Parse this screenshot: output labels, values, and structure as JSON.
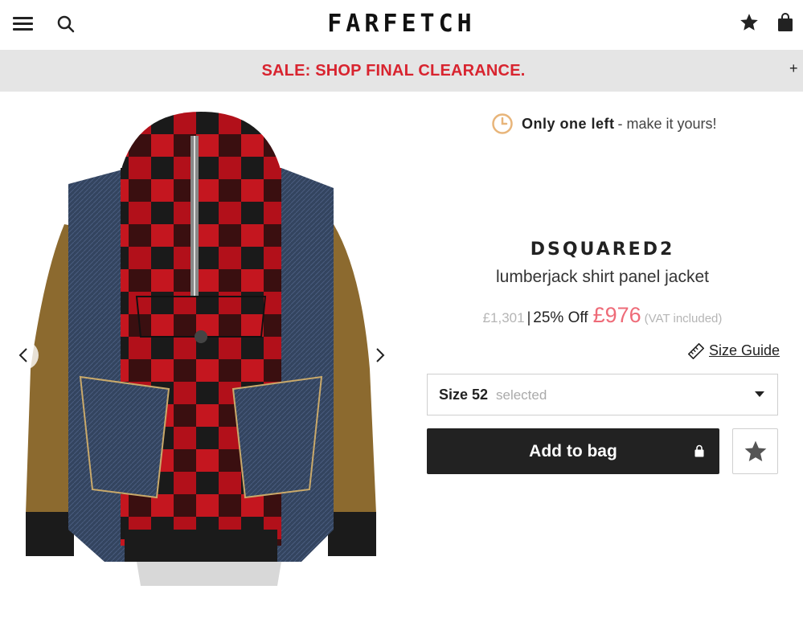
{
  "header": {
    "logo": "FARFETCH",
    "menu_icon": "hamburger-menu-icon",
    "search_icon": "search-icon",
    "wishlist_icon": "star-icon",
    "bag_icon": "shopping-bag-icon"
  },
  "banner": {
    "text": "SALE: SHOP FINAL CLEARANCE.",
    "expand": "+",
    "color": "#d8242f"
  },
  "gallery": {
    "prev_icon": "chevron-left-icon",
    "next_icon": "chevron-right-icon"
  },
  "product": {
    "stock_bold": "Only one left",
    "stock_rest": "- make it yours!",
    "brand": "DSQUARED2",
    "name": "lumberjack shirt panel jacket",
    "price_old": "£1,301",
    "separator": "|",
    "discount": "25% Off",
    "price_new": "£976",
    "vat": "(VAT included)",
    "size_guide": "Size Guide",
    "size_value": "Size 52",
    "size_hint": "selected",
    "add_to_bag": "Add to bag",
    "sale_price_color": "#ee6b78"
  }
}
